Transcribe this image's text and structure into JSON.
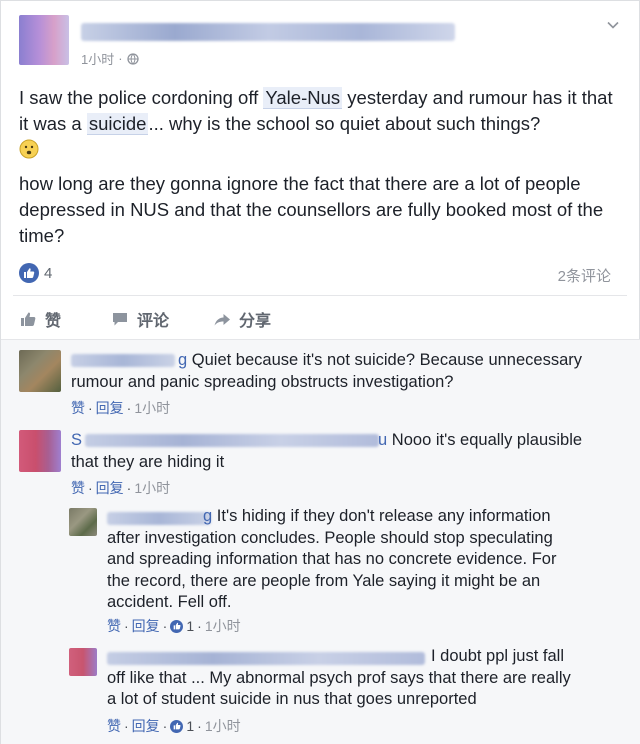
{
  "post": {
    "meta_time": "1小时",
    "meta_dot": "·",
    "paragraph1": {
      "before": "I saw the police cordoning off ",
      "tag1": "Yale-Nus",
      "middle": " yesterday and rumour has it that it was a ",
      "tag2": "suicide",
      "after": "... why is the school so quiet about such things?"
    },
    "paragraph2": "how long are they gonna ignore the fact that there are a lot of people depressed in NUS and that the counsellors are fully booked most of the time?",
    "like_count": "4",
    "comment_count": "2条评论",
    "actions": {
      "like": "赞",
      "comment": "评论",
      "share": "分享"
    }
  },
  "comments": [
    {
      "name_tail": "g",
      "line1": "Quiet because it's not suicide? Because unnecessary",
      "line2": "rumour and panic spreading obstructs investigation?",
      "like": "赞",
      "sep": "·",
      "reply": "回复",
      "time": "1小时"
    },
    {
      "name_head": "S",
      "name_tail": "u",
      "line1": "Nooo it's equally plausible",
      "line2": "that they are hiding it",
      "like": "赞",
      "sep": "·",
      "reply": "回复",
      "time": "1小时"
    },
    {
      "name_tail": "g",
      "line1": "It's hiding if they don't release any information",
      "line2": "after investigation concludes. People should stop speculating",
      "line3": "and spreading information that has no concrete evidence. For",
      "line4": "the record, there are people from Yale saying it might be an",
      "line5": "accident. Fell off.",
      "like": "赞",
      "sep": "·",
      "reply": "回复",
      "likes": "1",
      "time": "1小时"
    },
    {
      "name_tail": "",
      "line1": "I doubt ppl just fall",
      "line2": "off like that ... My abnormal psych prof says that there are really",
      "line3": "a lot of student suicide in nus that goes unreported",
      "like": "赞",
      "sep": "·",
      "reply": "回复",
      "likes": "1",
      "time": "1小时"
    }
  ],
  "colors": {
    "accent": "#4267b2",
    "muted": "#90949c",
    "comment_bg": "#f6f7f9"
  }
}
